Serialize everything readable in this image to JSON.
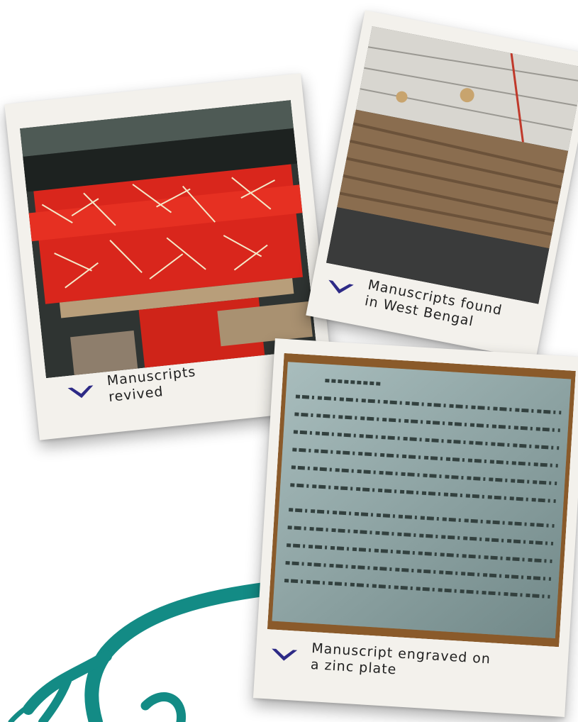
{
  "cards": [
    {
      "caption_line1": "Manuscripts",
      "caption_line2": "revived",
      "photo_icon": "red-cloth-bundles-photo"
    },
    {
      "caption_line1": "Manuscripts found",
      "caption_line2": "in West Bengal",
      "photo_icon": "palm-leaf-manuscripts-photo"
    },
    {
      "caption_line1": "Manuscript engraved on",
      "caption_line2": "a zinc plate",
      "photo_icon": "zinc-plate-photo"
    }
  ],
  "colors": {
    "chevron": "#2d2a86",
    "swirl": "#138b85",
    "card": "#f3f1ec"
  }
}
